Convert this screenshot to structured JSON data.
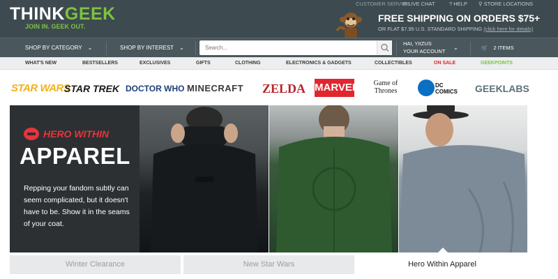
{
  "header": {
    "logo_think": "THINK",
    "logo_geek": "GEEK",
    "tagline": "JOIN IN. GEEK OUT.",
    "customer_service": "CUSTOMER SERVICE:",
    "live_chat": "LIVE CHAT",
    "help": "HELP",
    "store_locations": "STORE LOCATIONS",
    "shipping_headline": "FREE SHIPPING ON ORDERS $75+",
    "shipping_sub": "OR FLAT $7.95 U.S. STANDARD SHIPPING",
    "shipping_link": "(click here for details)"
  },
  "nav": {
    "shop_by_category": "SHOP BY CATEGORY",
    "shop_by_interest": "SHOP BY INTEREST",
    "search_placeholder": "Search...",
    "account_greeting": "HAI, YIIZUS",
    "account_label": "YOUR ACCOUNT",
    "cart_label": "2 ITEMS"
  },
  "categories": [
    "WHAT'S NEW",
    "BESTSELLERS",
    "EXCLUSIVES",
    "GIFTS",
    "CLOTHING",
    "ELECTRONICS & GADGETS",
    "COLLECTIBLES",
    "ON SALE",
    "GEEKPOINTS"
  ],
  "brands": [
    "STAR WARS",
    "STAR TREK",
    "DOCTOR WHO",
    "MINECRAFT",
    "ZELDA",
    "MARVEL",
    "Game of Thrones",
    "DC COMICS",
    "GEEKLABS"
  ],
  "hero": {
    "brand_title": "HERO WITHIN",
    "headline": "APPAREL",
    "body": "Repping your fandom subtly can seem complicated, but it doesn't have to be. Show it in the seams of your coat."
  },
  "tabs": [
    "Winter Clearance",
    "New Star Wars",
    "Hero Within Apparel"
  ],
  "colors": {
    "header_bg": "#3d4a4f",
    "accent_green": "#7dc242",
    "sale_red": "#d7262e"
  }
}
